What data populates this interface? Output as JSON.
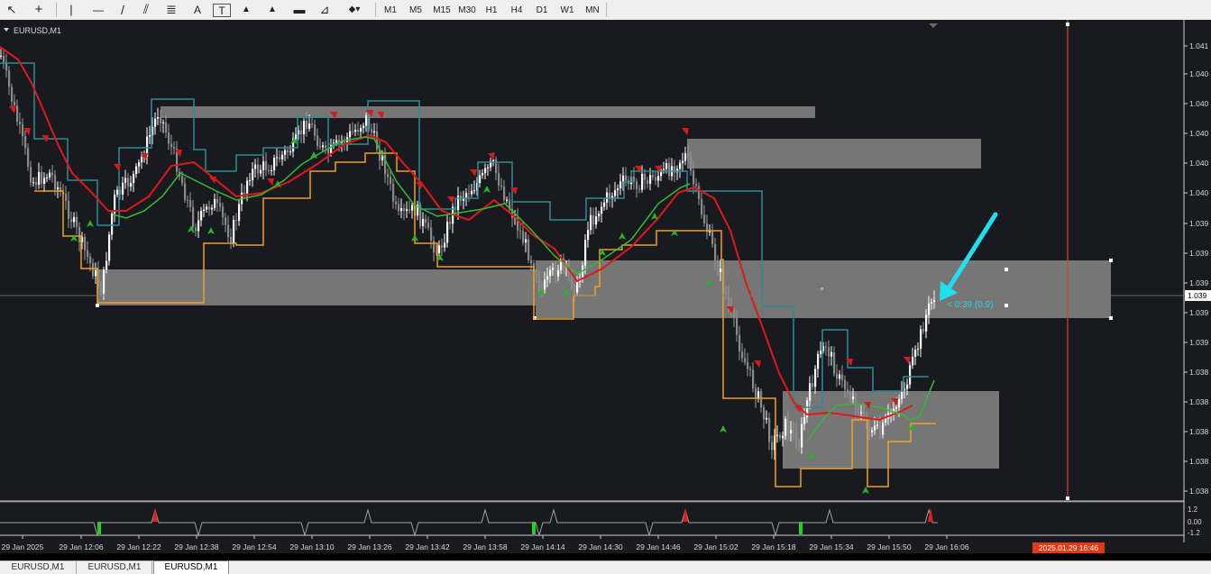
{
  "toolbar": {
    "tools": [
      {
        "name": "cursor-icon",
        "glyph": "↖"
      },
      {
        "name": "crosshair-icon",
        "glyph": "+"
      },
      {
        "name": "vertical-line-icon",
        "glyph": "|"
      },
      {
        "name": "horizontal-line-icon",
        "glyph": "—"
      },
      {
        "name": "trend-line-icon",
        "glyph": "/"
      },
      {
        "name": "equidistant-channel-icon",
        "glyph": "⫽"
      },
      {
        "name": "fibonacci-icon",
        "glyph": "≣"
      },
      {
        "name": "text-icon",
        "glyph": "A"
      },
      {
        "name": "text-label-icon",
        "glyph": "T"
      },
      {
        "name": "arrow-shape-icon",
        "glyph": "▲"
      },
      {
        "name": "rectangle-icon",
        "glyph": "▬"
      },
      {
        "name": "fibonacci-fan-icon",
        "glyph": "⊿"
      },
      {
        "name": "shapes-menu-icon",
        "glyph": "◆▾"
      }
    ],
    "timeframes": [
      "M1",
      "M5",
      "M15",
      "M30",
      "H1",
      "H4",
      "D1",
      "W1",
      "MN"
    ]
  },
  "chart": {
    "symbol_label": "EURUSD,M1",
    "price_labels": [
      "1.041",
      "1.040",
      "1.040",
      "1.040",
      "1.040",
      "1.040",
      "1.039",
      "1.039",
      "1.039",
      "1.039",
      "1.039",
      "1.038",
      "1.038",
      "1.038",
      "1.038",
      "1.038"
    ],
    "current_price": "1.039",
    "countdown_label": "< 0:39 (0.9)",
    "time_labels": [
      "29 Jan 2025",
      "29 Jan 12:06",
      "29 Jan 12:22",
      "29 Jan 12:38",
      "29 Jan 12:54",
      "29 Jan 13:10",
      "29 Jan 13:26",
      "29 Jan 13:42",
      "29 Jan 13:58",
      "29 Jan 14:14",
      "29 Jan 14:30",
      "29 Jan 14:46",
      "29 Jan 15:02",
      "29 Jan 15:18",
      "29 Jan 15:34",
      "29 Jan 15:50",
      "29 Jan 16:06"
    ],
    "cursor_time_label": "2025.01.29 16:46",
    "subwindow_labels": [
      "1.2",
      "0.00",
      "-1.2"
    ],
    "colors": {
      "background": "#181a1f",
      "zone": "#767676",
      "ma_red": "#e01818",
      "ma_green": "#33bb33",
      "channel_teal": "#2b8c96",
      "channel_orange": "#f0a020",
      "arrow_cyan": "#1ee0f0",
      "cursor_line": "#c0502a",
      "cursor_time_bg": "#e03a18"
    }
  },
  "tabs": [
    {
      "label": "EURUSD,M1",
      "active": false
    },
    {
      "label": "EURUSD,M1",
      "active": false
    },
    {
      "label": "EURUSD,M1",
      "active": true
    }
  ]
}
